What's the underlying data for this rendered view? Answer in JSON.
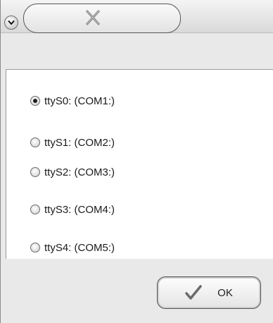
{
  "window": {
    "menu_icon": "chevron-down-icon",
    "close_icon": "close-icon"
  },
  "ports": [
    {
      "label": "ttyS0: (COM1:)",
      "selected": true
    },
    {
      "label": "ttyS1: (COM2:)",
      "selected": false
    },
    {
      "label": "ttyS2: (COM3:)",
      "selected": false
    },
    {
      "label": "ttyS3: (COM4:)",
      "selected": false
    },
    {
      "label": "ttyS4: (COM5:)",
      "selected": false
    }
  ],
  "ok_button": {
    "label": "OK",
    "icon": "checkmark-icon"
  }
}
